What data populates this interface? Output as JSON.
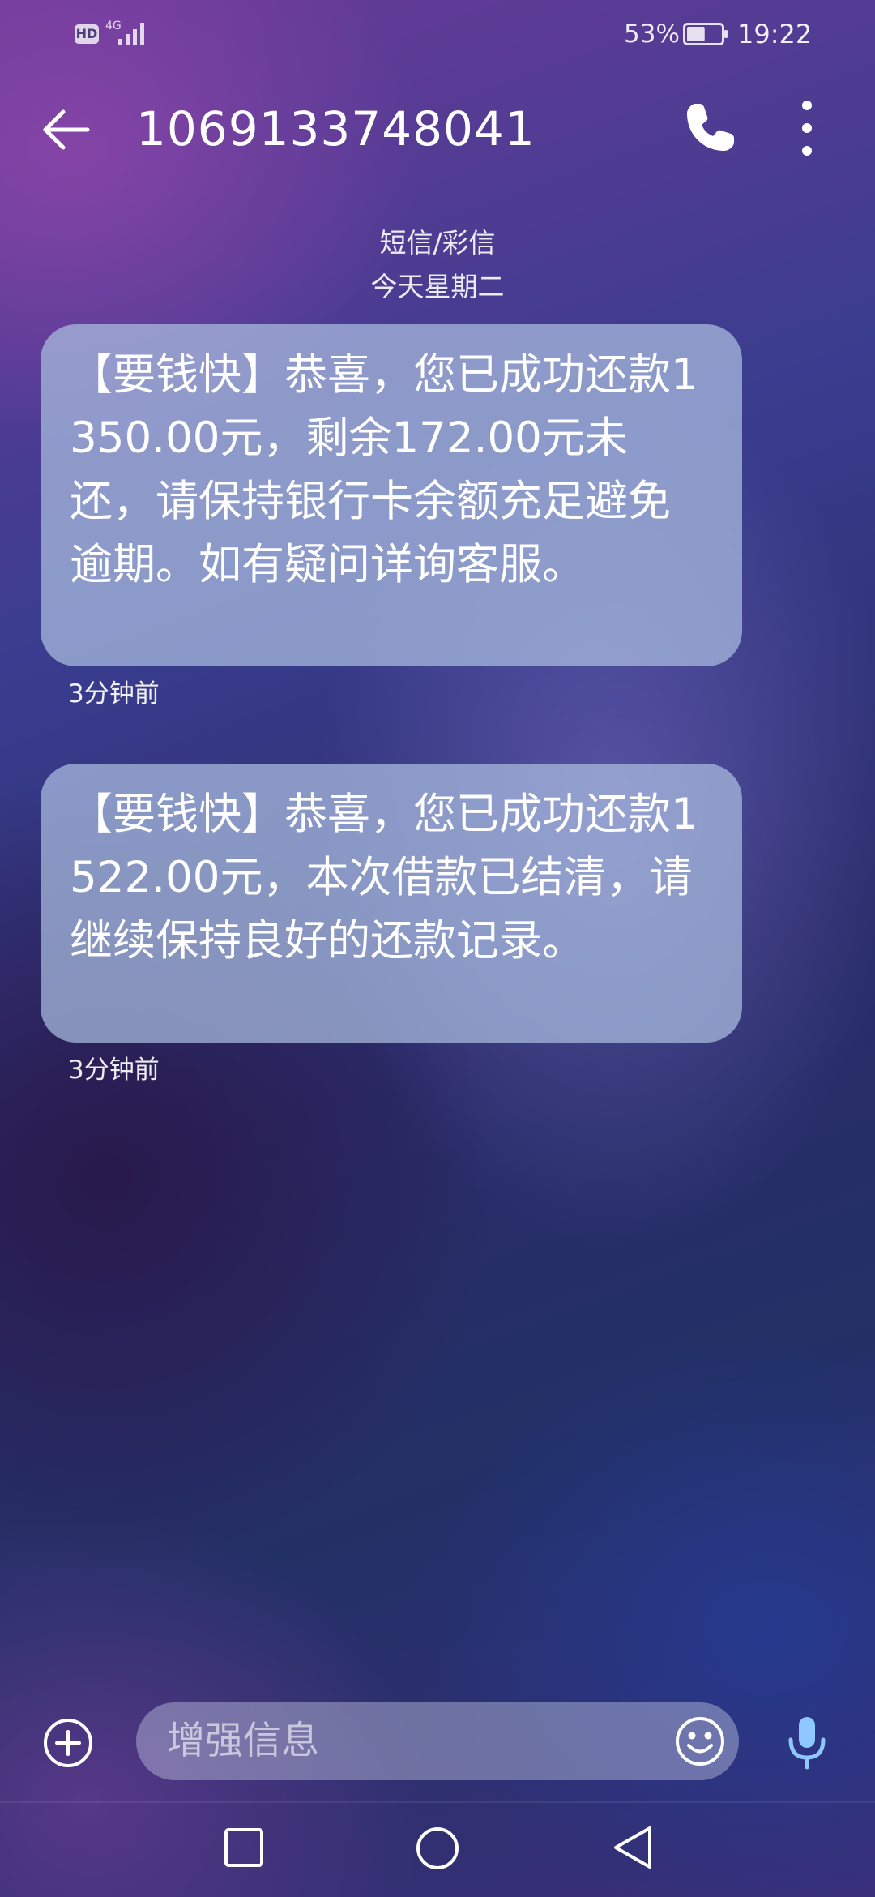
{
  "status_bar": {
    "hd": "HD",
    "network": "4G",
    "battery_percent": "53%",
    "battery_level": 0.53,
    "time": "19:22"
  },
  "header": {
    "title": "1069133748041",
    "back_icon": "arrow-left-icon",
    "call_icon": "phone-icon",
    "more_icon": "more-vertical-icon"
  },
  "conversation": {
    "type_label": "短信/彩信",
    "date_label": "今天星期二"
  },
  "messages": [
    {
      "text": "【要钱快】恭喜，您已成功还款1350.00元，剩余172.00元未还，请保持银行卡余额充足避免逾期。如有疑问详询客服。",
      "time": "3分钟前"
    },
    {
      "text": "【要钱快】恭喜，您已成功还款1522.00元，本次借款已结清，请继续保持良好的还款记录。",
      "time": "3分钟前"
    }
  ],
  "composer": {
    "placeholder": "增强信息",
    "add_icon": "plus-circle-icon",
    "emoji_icon": "smiley-icon",
    "mic_icon": "microphone-icon"
  },
  "nav_bar": {
    "recents_icon": "square-icon",
    "home_icon": "circle-icon",
    "back_icon": "triangle-back-icon"
  },
  "colors": {
    "bubble": "#a8bee1",
    "mic_accent": "#8fc7ff"
  }
}
